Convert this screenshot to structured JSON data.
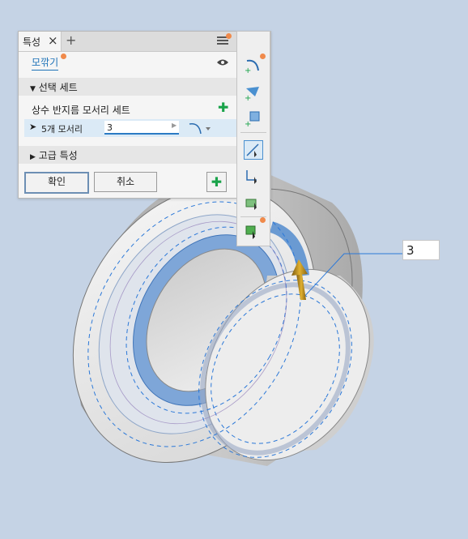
{
  "panel": {
    "tab_label": "특성",
    "feature_name": "모깎기",
    "selection_set_header": "선택 세트",
    "constant_radius_label": "상수 반지름 모서리 세트",
    "edge_count_label": "5개 모서리",
    "radius_value": "3",
    "advanced_header": "고급 특성",
    "ok_button": "확인",
    "cancel_button": "취소"
  },
  "viewport": {
    "dimension_callout": "3"
  },
  "colors": {
    "background": "#c5d3e5",
    "accent_blue": "#1f73b8",
    "notify_dot": "#f08a4b",
    "add_green": "#1aa34a"
  },
  "icons": [
    "close-icon",
    "add-tab-icon",
    "hamburger-menu-icon",
    "eye-icon",
    "plus-icon",
    "cursor-icon",
    "fillet-profile-icon",
    "clear-icon",
    "constant-fillet-icon",
    "variable-fillet-icon",
    "setback-fillet-icon",
    "edge-select-icon",
    "loop-select-icon",
    "feature-select-icon",
    "solid-select-icon"
  ]
}
